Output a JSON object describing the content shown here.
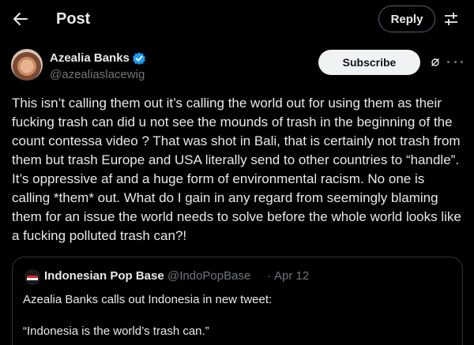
{
  "header": {
    "title": "Post",
    "reply_label": "Reply",
    "back_icon": "back-arrow-icon",
    "filter_icon": "sliders-icon"
  },
  "author": {
    "display_name": "Azealia Banks",
    "handle": "@azealiaslacewig",
    "verified": true,
    "verified_color": "#1d9bf0"
  },
  "actions": {
    "subscribe_label": "Subscribe",
    "grok_icon": "grok-icon",
    "more_icon": "more-icon"
  },
  "tweet": {
    "text": "This isn’t calling them out it’s calling the world out for using them as their fucking trash can did u not see the mounds of trash in the beginning of the count contessa video ? That was shot in Bali, that is certainly not trash from them but trash Europe and USA literally send to other countries to “handle”. It’s oppressive af and a huge form of environmental racism. No one is calling *them* out. What do I gain in any regard from seemingly blaming them for an issue the world needs to solve before the whole world looks like a fucking polluted trash can?!"
  },
  "quote": {
    "display_name": "Indonesian Pop Base",
    "handle": "@IndoPopBase",
    "separator": "·",
    "date": "Apr 12",
    "line1": "Azealia Banks calls out Indonesia in new tweet:",
    "line2": "“Indonesia is the world’s trash can.”"
  },
  "colors": {
    "background": "#000000",
    "text_primary": "#e7e9ea",
    "text_secondary": "#71767b",
    "border": "#2f3336",
    "accent": "#1d9bf0"
  }
}
